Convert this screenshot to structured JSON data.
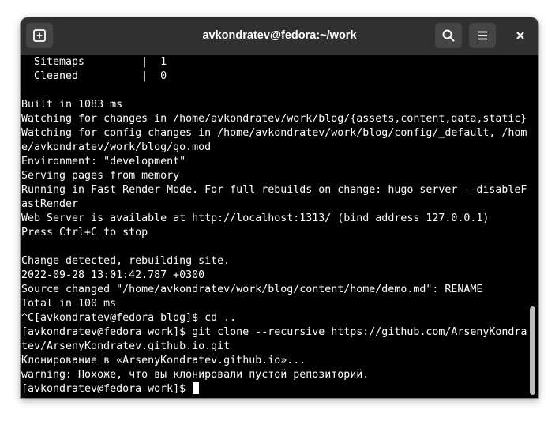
{
  "window": {
    "title": "avkondratev@fedora:~/work"
  },
  "titlebar": {
    "new_tab_icon": "new-tab-icon",
    "search_icon": "search-icon",
    "menu_icon": "hamburger-menu-icon",
    "close_icon": "close-icon"
  },
  "terminal": {
    "lines": [
      "  Sitemaps         |  1",
      "  Cleaned          |  0",
      "",
      "Built in 1083 ms",
      "Watching for changes in /home/avkondratev/work/blog/{assets,content,data,static}",
      "Watching for config changes in /home/avkondratev/work/blog/config/_default, /hom",
      "e/avkondratev/work/blog/go.mod",
      "Environment: \"development\"",
      "Serving pages from memory",
      "Running in Fast Render Mode. For full rebuilds on change: hugo server --disableF",
      "astRender",
      "Web Server is available at http://localhost:1313/ (bind address 127.0.0.1)",
      "Press Ctrl+C to stop",
      "",
      "Change detected, rebuilding site.",
      "2022-09-28 13:01:42.787 +0300",
      "Source changed \"/home/avkondratev/work/blog/content/home/demo.md\": RENAME",
      "Total in 100 ms",
      "^C[avkondratev@fedora blog]$ cd ..",
      "[avkondratev@fedora work]$ git clone --recursive https://github.com/ArsenyKondra",
      "tev/ArsenyKondratev.github.io.git",
      "Клонирование в «ArsenyKondratev.github.io»...",
      "warning: Похоже, что вы клонировали пустой репозиторий."
    ],
    "prompt": "[avkondratev@fedora work]$ "
  },
  "colors": {
    "titlebar_bg": "#303030",
    "button_bg": "#454545",
    "terminal_bg": "#000000",
    "terminal_fg": "#ffffff",
    "scrollbar_thumb": "#bdbdbd"
  }
}
